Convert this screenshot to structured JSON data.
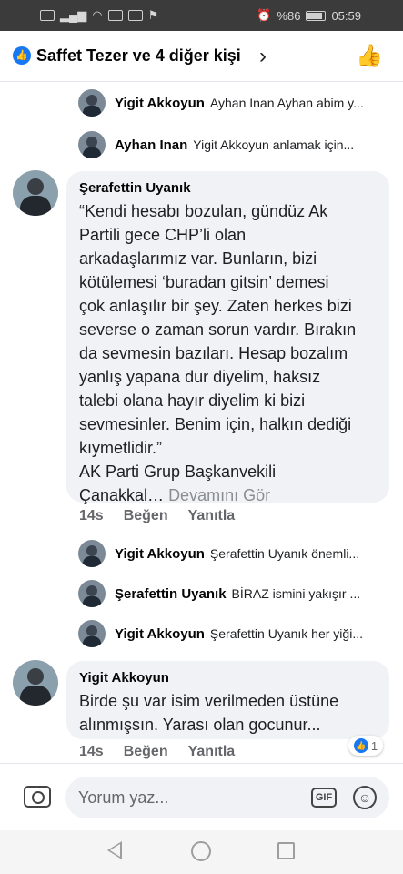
{
  "status_bar": {
    "battery_text": "%86",
    "time": "05:59"
  },
  "header": {
    "title": "Saffet Tezer ve 4 diğer kişi",
    "icons": [
      "like-badge-icon",
      "chevron-right-icon",
      "thumbs-up-icon"
    ]
  },
  "replies_top": [
    {
      "name": "Yigit Akkoyun",
      "text": "Ayhan Inan Ayhan abim y..."
    },
    {
      "name": "Ayhan Inan",
      "text": "Yigit Akkoyun anlamak için..."
    }
  ],
  "comment_main": {
    "name": "Şerafettin Uyanık",
    "text": "“Kendi hesabı bozulan, gündüz Ak\nPartili gece CHP’li olan\narkadaşlarımız var. Bunların, bizi\nkötülemesi ‘buradan gitsin’ demesi\nçok anlaşılır bir şey. Zaten herkes bizi\nseverse o zaman sorun vardır. Bırakın\nda sevmesin bazıları. Hesap bozalım\nyanlış yapana dur diyelim, haksız\ntalebi olana hayır diyelim ki bizi\nsevmesinler. Benim için, halkın dediği\nkıymetlidir.”\nAK Parti Grup Başkanvekili\nÇanakkal…",
    "see_more": "Devamını Gör",
    "time": "14s",
    "like_label": "Beğen",
    "reply_label": "Yanıtla"
  },
  "replies_middle": [
    {
      "name": "Yigit Akkoyun",
      "text": "Şerafettin Uyanık önemli..."
    },
    {
      "name": "Şerafettin Uyanık",
      "text": "BİRAZ ismini yakışır ..."
    },
    {
      "name": "Yigit Akkoyun",
      "text": "Şerafettin Uyanık her yiği..."
    }
  ],
  "comment_second": {
    "name": "Yigit Akkoyun",
    "text": "Birde şu var isim verilmeden üstüne\nalınmışsın. Yarası olan gocunur...",
    "time": "14s",
    "like_label": "Beğen",
    "reply_label": "Yanıtla",
    "reaction_count": "1"
  },
  "composer": {
    "placeholder": "Yorum yaz...",
    "gif_label": "GIF"
  }
}
